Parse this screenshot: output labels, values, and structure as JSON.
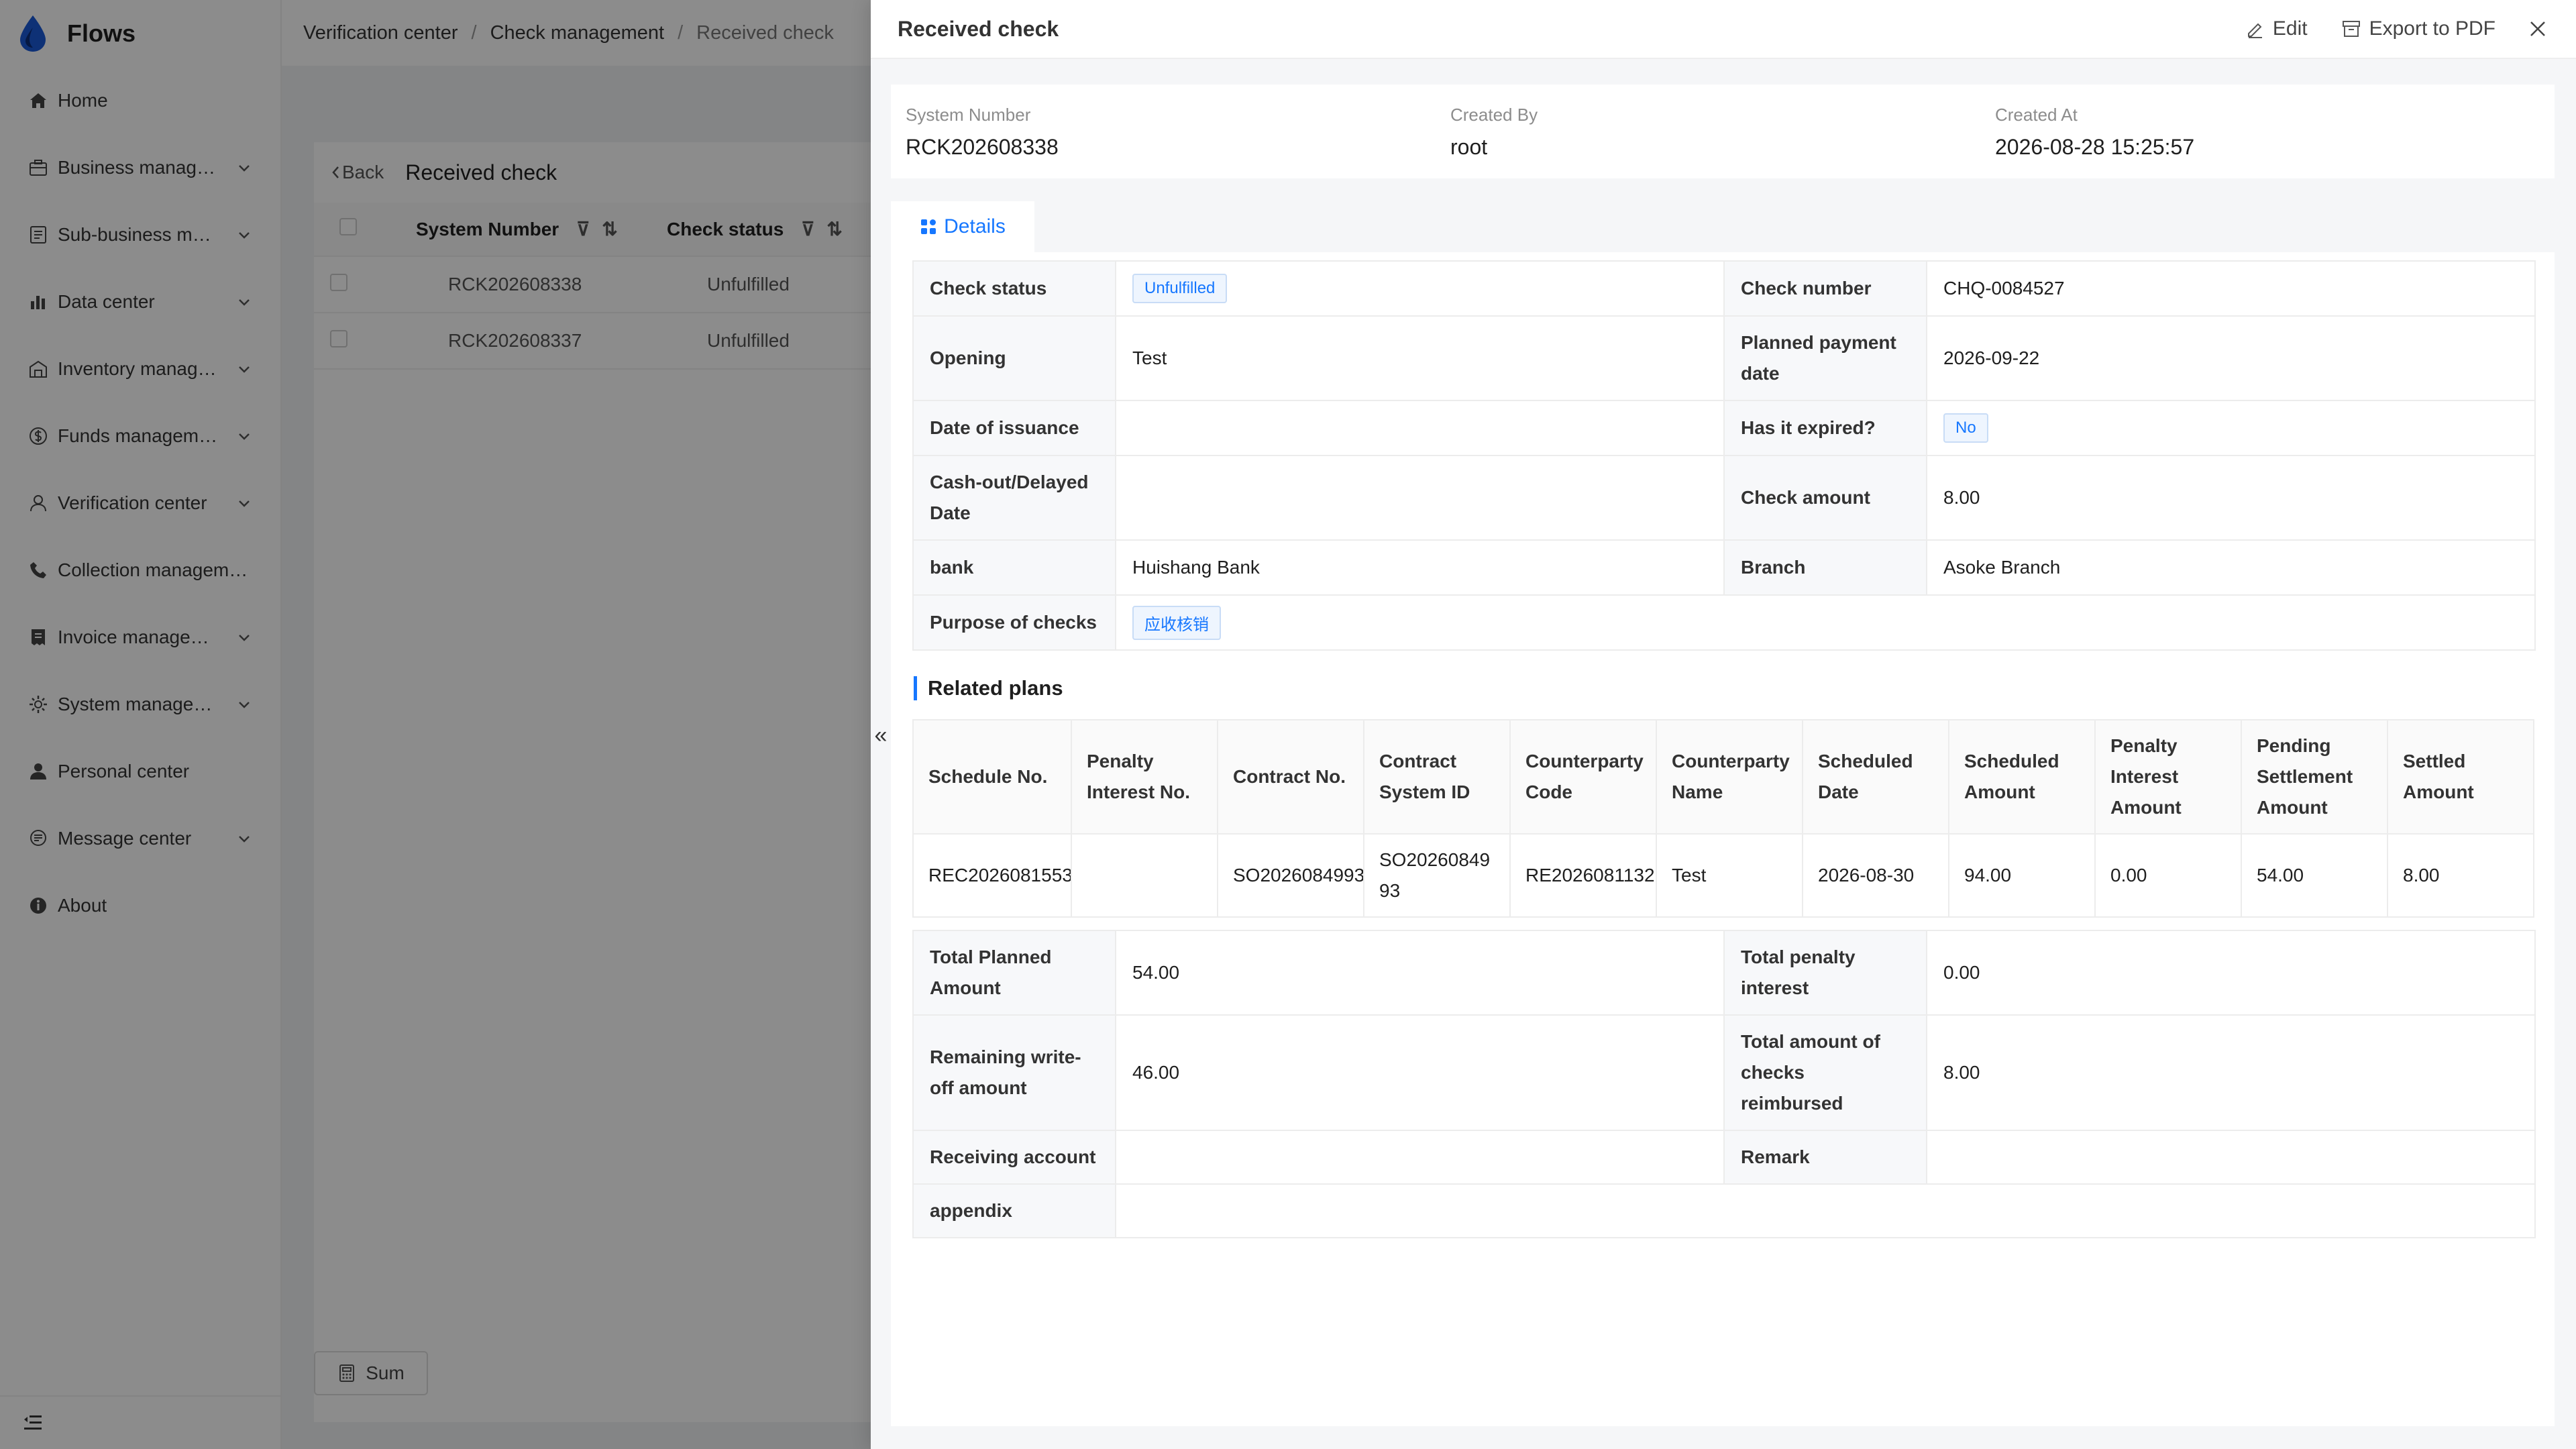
{
  "app": {
    "brand": "Flows"
  },
  "sidebar": {
    "items": [
      {
        "label": "Home",
        "icon": "home-icon",
        "expandable": false
      },
      {
        "label": "Business manag…",
        "icon": "briefcase-icon",
        "expandable": true
      },
      {
        "label": "Sub-business m…",
        "icon": "document-icon",
        "expandable": true
      },
      {
        "label": "Data center",
        "icon": "bar-chart-icon",
        "expandable": true
      },
      {
        "label": "Inventory manag…",
        "icon": "warehouse-icon",
        "expandable": true
      },
      {
        "label": "Funds managem…",
        "icon": "money-icon",
        "expandable": true
      },
      {
        "label": "Verification center",
        "icon": "user-check-icon",
        "expandable": true
      },
      {
        "label": "Collection managem…",
        "icon": "phone-icon",
        "expandable": false
      },
      {
        "label": "Invoice manage…",
        "icon": "invoice-icon",
        "expandable": true
      },
      {
        "label": "System manage…",
        "icon": "gear-icon",
        "expandable": true
      },
      {
        "label": "Personal center",
        "icon": "person-icon",
        "expandable": false
      },
      {
        "label": "Message center",
        "icon": "message-icon",
        "expandable": true
      },
      {
        "label": "About",
        "icon": "info-icon",
        "expandable": false
      }
    ]
  },
  "breadcrumb": {
    "items": [
      "Verification center",
      "Check management",
      "Received check"
    ],
    "separator": "/"
  },
  "list_page": {
    "back_label": "Back",
    "title": "Received check",
    "columns": [
      "System Number",
      "Check status"
    ],
    "rows": [
      {
        "system_number": "RCK202608338",
        "status": "Unfulfilled"
      },
      {
        "system_number": "RCK202608337",
        "status": "Unfulfilled"
      }
    ],
    "sum_label": "Sum"
  },
  "drawer": {
    "title": "Received check",
    "edit_label": "Edit",
    "export_label": "Export to PDF",
    "collapse_glyph": "«"
  },
  "summary": {
    "system_number_label": "System Number",
    "system_number": "RCK202608338",
    "created_by_label": "Created By",
    "created_by": "root",
    "created_at_label": "Created At",
    "created_at": "2026-08-28 15:25:57"
  },
  "tabs": {
    "details": "Details"
  },
  "details": {
    "check_status_label": "Check status",
    "check_status": "Unfulfilled",
    "check_number_label": "Check number",
    "check_number": "CHQ-0084527",
    "opening_label": "Opening",
    "opening": "Test",
    "planned_payment_date_label": "Planned payment date",
    "planned_payment_date": "2026-09-22",
    "date_of_issuance_label": "Date of issuance",
    "date_of_issuance": "",
    "has_expired_label": "Has it expired?",
    "has_expired": "No",
    "cashout_label": "Cash-out/Delayed Date",
    "cashout": "",
    "check_amount_label": "Check amount",
    "check_amount": "8.00",
    "bank_label": "bank",
    "bank": "Huishang Bank",
    "branch_label": "Branch",
    "branch": "Asoke Branch",
    "purpose_label": "Purpose of checks",
    "purpose": "应收核销"
  },
  "related_plans": {
    "title": "Related plans",
    "columns": [
      "Schedule No.",
      "Penalty Interest No.",
      "Contract No.",
      "Contract System ID",
      "Counterparty Code",
      "Counterparty Name",
      "Scheduled Date",
      "Scheduled Amount",
      "Penalty Interest Amount",
      "Pending Settlement Amount",
      "Settled Amount"
    ],
    "row": {
      "schedule_no": "REC2026081553",
      "penalty_interest_no": "",
      "contract_no": "SO2026084993",
      "contract_system_id": "SO2026084993",
      "counterparty_code": "RE2026081132",
      "counterparty_name": "Test",
      "scheduled_date": "2026-08-30",
      "scheduled_amount": "94.00",
      "penalty_interest_amount": "0.00",
      "pending_settlement_amount": "54.00",
      "settled_amount": "8.00"
    }
  },
  "totals": {
    "total_planned_label": "Total Planned Amount",
    "total_planned": "54.00",
    "total_penalty_label": "Total penalty interest",
    "total_penalty": "0.00",
    "remaining_label": "Remaining write-off amount",
    "remaining": "46.00",
    "total_checks_label": "Total amount of checks reimbursed",
    "total_checks": "8.00",
    "receiving_account_label": "Receiving account",
    "receiving_account": "",
    "remark_label": "Remark",
    "remark": "",
    "appendix_label": "appendix",
    "appendix": ""
  },
  "colors": {
    "accent": "#1677ff",
    "link": "#1677ff",
    "overlay": "rgba(0,0,0,0.45)"
  }
}
